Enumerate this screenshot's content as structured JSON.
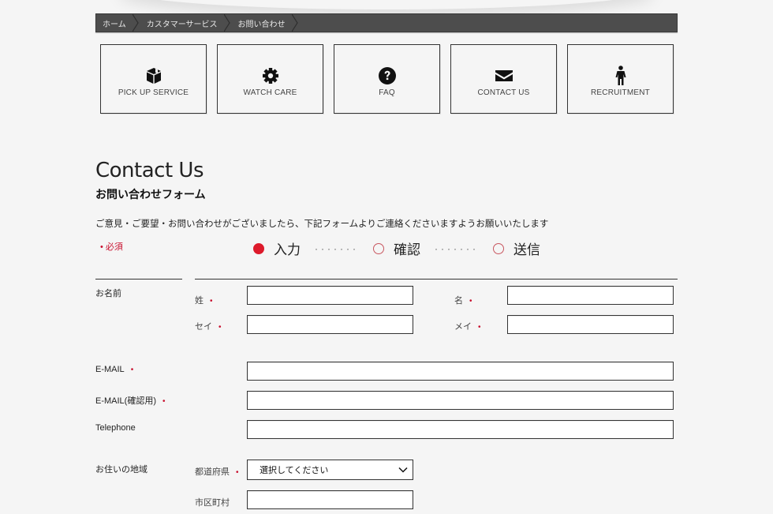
{
  "breadcrumb": [
    {
      "label": "ホーム"
    },
    {
      "label": "カスタマーサービス"
    },
    {
      "label": "お問い合わせ"
    }
  ],
  "nav_boxes": [
    {
      "label": "PICK UP SERVICE",
      "icon": "package-icon"
    },
    {
      "label": "WATCH CARE",
      "icon": "gear-icon"
    },
    {
      "label": "FAQ",
      "icon": "question-circle-icon"
    },
    {
      "label": "CONTACT US",
      "icon": "envelope-icon"
    },
    {
      "label": "RECRUITMENT",
      "icon": "person-icon"
    }
  ],
  "page": {
    "title": "Contact Us",
    "subtitle": "お問い合わせフォーム",
    "intro": "ご意見・ご要望・お問い合わせがございましたら、下記フォームよりご連絡くださいますようお願いいたします",
    "required_note": "• 必須"
  },
  "steps": [
    {
      "label": "入力",
      "active": true
    },
    {
      "label": "確認",
      "active": false
    },
    {
      "label": "送信",
      "active": false
    }
  ],
  "steps_separator": "·······",
  "required_mark": "•",
  "form": {
    "name_section": "お名前",
    "last_name_label": "姓",
    "first_name_label": "名",
    "last_name_kana_label": "セイ",
    "first_name_kana_label": "メイ",
    "email_label": "E-MAIL",
    "email_confirm_label": "E-MAIL(確認用)",
    "telephone_label": "Telephone",
    "address_section": "お住いの地域",
    "prefecture_label": "都道府県",
    "prefecture_selected": "選択してください",
    "city_label": "市区町村",
    "values": {
      "last_name": "",
      "first_name": "",
      "last_name_kana": "",
      "first_name_kana": "",
      "email": "",
      "email_confirm": "",
      "telephone": "",
      "city": ""
    }
  },
  "colors": {
    "accent_red": "#dd1a2b",
    "breadcrumb_bg": "#4d4d4d",
    "page_bg": "#f5f5f5"
  }
}
